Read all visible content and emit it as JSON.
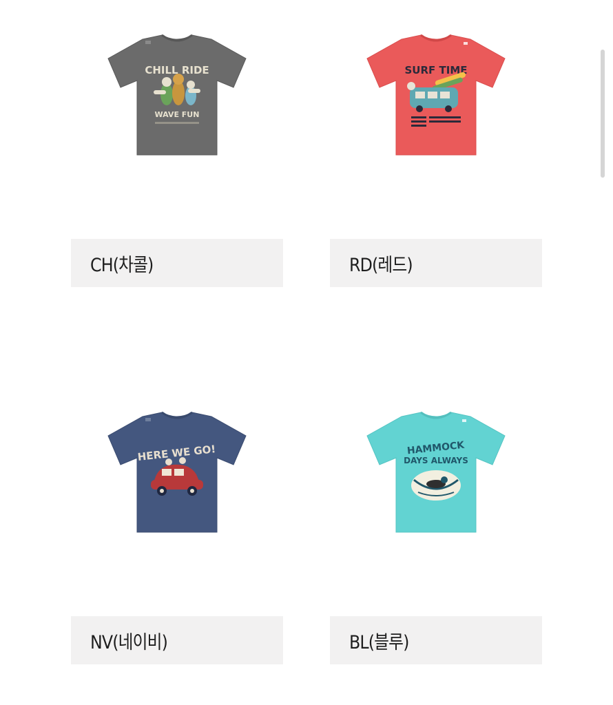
{
  "products": [
    {
      "label": "CH(차콜)",
      "shirt_color": "#6b6b6b",
      "print_colors": [
        "#e7e1cf",
        "#c8963e",
        "#6aa35a",
        "#7bb6c9"
      ],
      "graphic": {
        "lines": [
          "CHILL RIDE",
          "WAVE FUN"
        ]
      }
    },
    {
      "label": "RD(레드)",
      "shirt_color": "#ea5a5a",
      "print_colors": [
        "#2b2a3a",
        "#5fa8b2",
        "#f4c14a",
        "#e8e3d6"
      ],
      "graphic": {
        "lines": [
          "SURF TIME"
        ]
      }
    },
    {
      "label": "NV(네이비)",
      "shirt_color": "#44577f",
      "print_colors": [
        "#e8dfcf",
        "#b8393a",
        "#f0e6d6"
      ],
      "graphic": {
        "lines": [
          "HERE WE GO!"
        ]
      }
    },
    {
      "label": "BL(블루)",
      "shirt_color": "#62d3d2",
      "print_colors": [
        "#20576a",
        "#f2efe0",
        "#2f2f2f"
      ],
      "graphic": {
        "lines": [
          "HAMMOCK",
          "DAYS ALWAYS"
        ]
      }
    }
  ]
}
